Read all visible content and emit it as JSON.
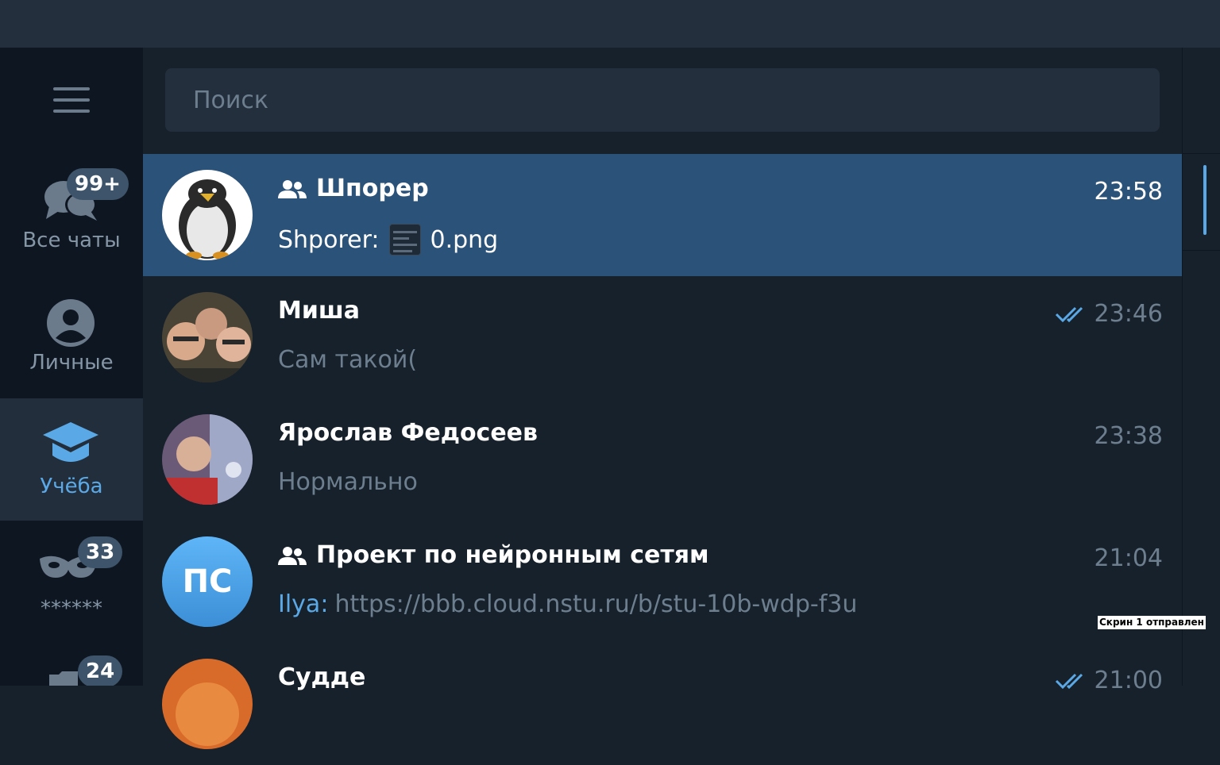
{
  "folders": [
    {
      "label": "Все чаты",
      "badge": "99+",
      "icon": "chats-icon"
    },
    {
      "label": "Личные",
      "badge": "",
      "icon": "person-icon"
    },
    {
      "label": "Учёба",
      "badge": "",
      "icon": "graduation-cap-icon"
    },
    {
      "label": "******",
      "badge": "33",
      "icon": "mask-icon"
    },
    {
      "label": "",
      "badge": "24",
      "icon": "folder-icon"
    }
  ],
  "search": {
    "placeholder": "Поиск"
  },
  "chats": [
    {
      "name": "Шпорер",
      "group": true,
      "time": "23:58",
      "sender": "Shporer:",
      "preview": "0.png",
      "read": false
    },
    {
      "name": "Миша",
      "group": false,
      "time": "23:46",
      "sender": "",
      "preview": "Сам такой(",
      "read": true
    },
    {
      "name": "Ярослав Федосеев",
      "group": false,
      "time": "23:38",
      "sender": "",
      "preview": "Нормально",
      "read": false
    },
    {
      "name": "Проект по нейронным сетям",
      "group": true,
      "time": "21:04",
      "sender": "Ilya:",
      "preview": "https://bbb.cloud.nstu.ru/b/stu-10b-wdp-f3u",
      "initials": "ПС",
      "read": false
    },
    {
      "name": "Судде",
      "group": false,
      "time": "21:00",
      "sender": "",
      "preview": "",
      "read": true
    }
  ],
  "toast": "Скрин 1 отправлен",
  "colors": {
    "accent": "#5aa9e6",
    "selected": "#2b5278",
    "background": "#17212b",
    "sidebar": "#0e1621"
  }
}
